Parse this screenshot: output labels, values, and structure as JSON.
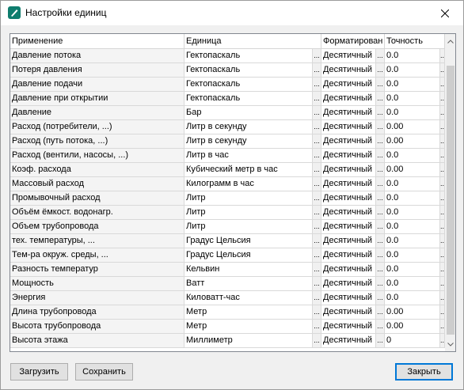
{
  "window": {
    "title": "Настройки единиц"
  },
  "table": {
    "headers": [
      "Применение",
      "Единица",
      "Форматирован",
      "Точность"
    ],
    "rows": [
      {
        "app": "Давление потока",
        "unit": "Гектопаскаль",
        "format": "Десятичный",
        "precision": "0.0"
      },
      {
        "app": "Потеря давления",
        "unit": "Гектопаскаль",
        "format": "Десятичный",
        "precision": "0.0"
      },
      {
        "app": "Давление подачи",
        "unit": "Гектопаскаль",
        "format": "Десятичный",
        "precision": "0.0"
      },
      {
        "app": "Давление при открытии",
        "unit": "Гектопаскаль",
        "format": "Десятичный",
        "precision": "0.0"
      },
      {
        "app": "Давление",
        "unit": "Бар",
        "format": "Десятичный",
        "precision": "0.0"
      },
      {
        "app": "Расход (потребители, ...)",
        "unit": "Литр в секунду",
        "format": "Десятичный",
        "precision": "0.00"
      },
      {
        "app": "Расход (путь потока, ...)",
        "unit": "Литр в секунду",
        "format": "Десятичный",
        "precision": "0.00"
      },
      {
        "app": "Расход (вентили, насосы, ...)",
        "unit": "Литр в час",
        "format": "Десятичный",
        "precision": "0.0"
      },
      {
        "app": "Коэф. расхода",
        "unit": "Кубический метр в час",
        "format": "Десятичный",
        "precision": "0.00"
      },
      {
        "app": "Массовый расход",
        "unit": "Килограмм в час",
        "format": "Десятичный",
        "precision": "0.0"
      },
      {
        "app": "Промывочный расход",
        "unit": "Литр",
        "format": "Десятичный",
        "precision": "0.0"
      },
      {
        "app": "Объём ёмкост. водонагр.",
        "unit": "Литр",
        "format": "Десятичный",
        "precision": "0.0"
      },
      {
        "app": "Объем трубопровода",
        "unit": "Литр",
        "format": "Десятичный",
        "precision": "0.0"
      },
      {
        "app": "тех. температуры, ...",
        "unit": "Градус Цельсия",
        "format": "Десятичный",
        "precision": "0.0"
      },
      {
        "app": "Тем-ра окруж. среды, ...",
        "unit": "Градус Цельсия",
        "format": "Десятичный",
        "precision": "0.0"
      },
      {
        "app": "Разность температур",
        "unit": "Кельвин",
        "format": "Десятичный",
        "precision": "0.0"
      },
      {
        "app": "Мощность",
        "unit": "Ватт",
        "format": "Десятичный",
        "precision": "0.0"
      },
      {
        "app": "Энергия",
        "unit": "Киловатт-час",
        "format": "Десятичный",
        "precision": "0.0"
      },
      {
        "app": "Длина трубопровода",
        "unit": "Метр",
        "format": "Десятичный",
        "precision": "0.00"
      },
      {
        "app": "Высота трубопровода",
        "unit": "Метр",
        "format": "Десятичный",
        "precision": "0.00"
      },
      {
        "app": "Высота этажа",
        "unit": "Миллиметр",
        "format": "Десятичный",
        "precision": "0"
      }
    ],
    "ellipsis": "..."
  },
  "buttons": {
    "load": "Загрузить",
    "save": "Сохранить",
    "close": "Закрыть"
  },
  "colors": {
    "app_icon": "#0f7d6e",
    "primary_border": "#0078d7"
  },
  "icons": {
    "app": "app-logo-icon",
    "close": "close-icon",
    "scroll_up": "chevron-up-icon",
    "scroll_down": "chevron-down-icon"
  }
}
